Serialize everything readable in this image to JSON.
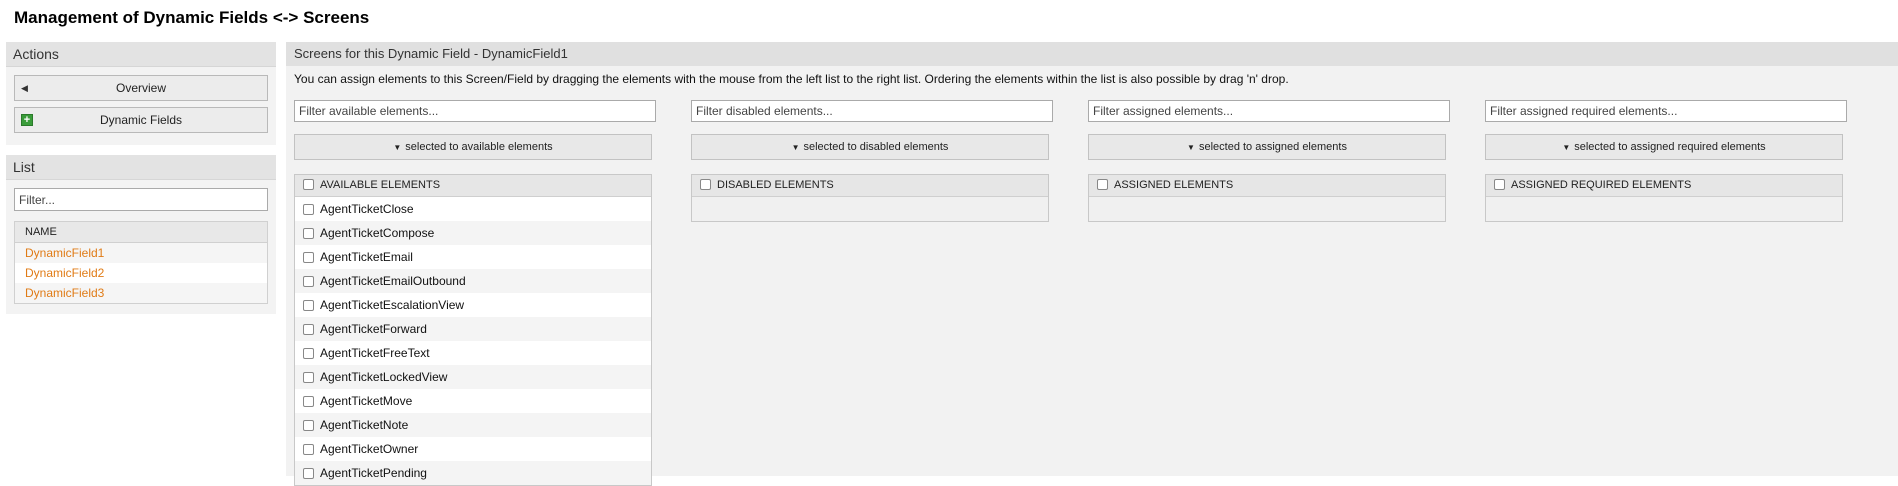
{
  "page": {
    "title": "Management of Dynamic Fields <-> Screens"
  },
  "sidebar": {
    "actions": {
      "title": "Actions",
      "buttons": [
        {
          "label": "Overview",
          "icon": "caret-left-icon"
        },
        {
          "label": "Dynamic Fields",
          "icon": "plus-icon"
        }
      ]
    },
    "list": {
      "title": "List",
      "filter_placeholder": "Filter...",
      "column": "NAME",
      "items": [
        "DynamicField1",
        "DynamicField2",
        "DynamicField3"
      ]
    }
  },
  "main": {
    "title": "Screens for this Dynamic Field - DynamicField1",
    "instructions": "You can assign elements to this Screen/Field by dragging the elements with the mouse from the left list to the right list. Ordering the elements within the list is also possible by drag 'n' drop.",
    "columns": [
      {
        "filter_placeholder": "Filter available elements...",
        "button": "selected to available elements",
        "header": "AVAILABLE ELEMENTS",
        "items": [
          "AgentTicketClose",
          "AgentTicketCompose",
          "AgentTicketEmail",
          "AgentTicketEmailOutbound",
          "AgentTicketEscalationView",
          "AgentTicketForward",
          "AgentTicketFreeText",
          "AgentTicketLockedView",
          "AgentTicketMove",
          "AgentTicketNote",
          "AgentTicketOwner",
          "AgentTicketPending"
        ]
      },
      {
        "filter_placeholder": "Filter disabled elements...",
        "button": "selected to disabled elements",
        "header": "DISABLED ELEMENTS",
        "items": []
      },
      {
        "filter_placeholder": "Filter assigned elements...",
        "button": "selected to assigned elements",
        "header": "ASSIGNED ELEMENTS",
        "items": []
      },
      {
        "filter_placeholder": "Filter assigned required elements...",
        "button": "selected to assigned required elements",
        "header": "ASSIGNED REQUIRED ELEMENTS",
        "items": []
      }
    ]
  },
  "colors": {
    "link": "#e07b16",
    "header_bg": "#e0e0e0",
    "panel_bg": "#f2f2f2"
  }
}
